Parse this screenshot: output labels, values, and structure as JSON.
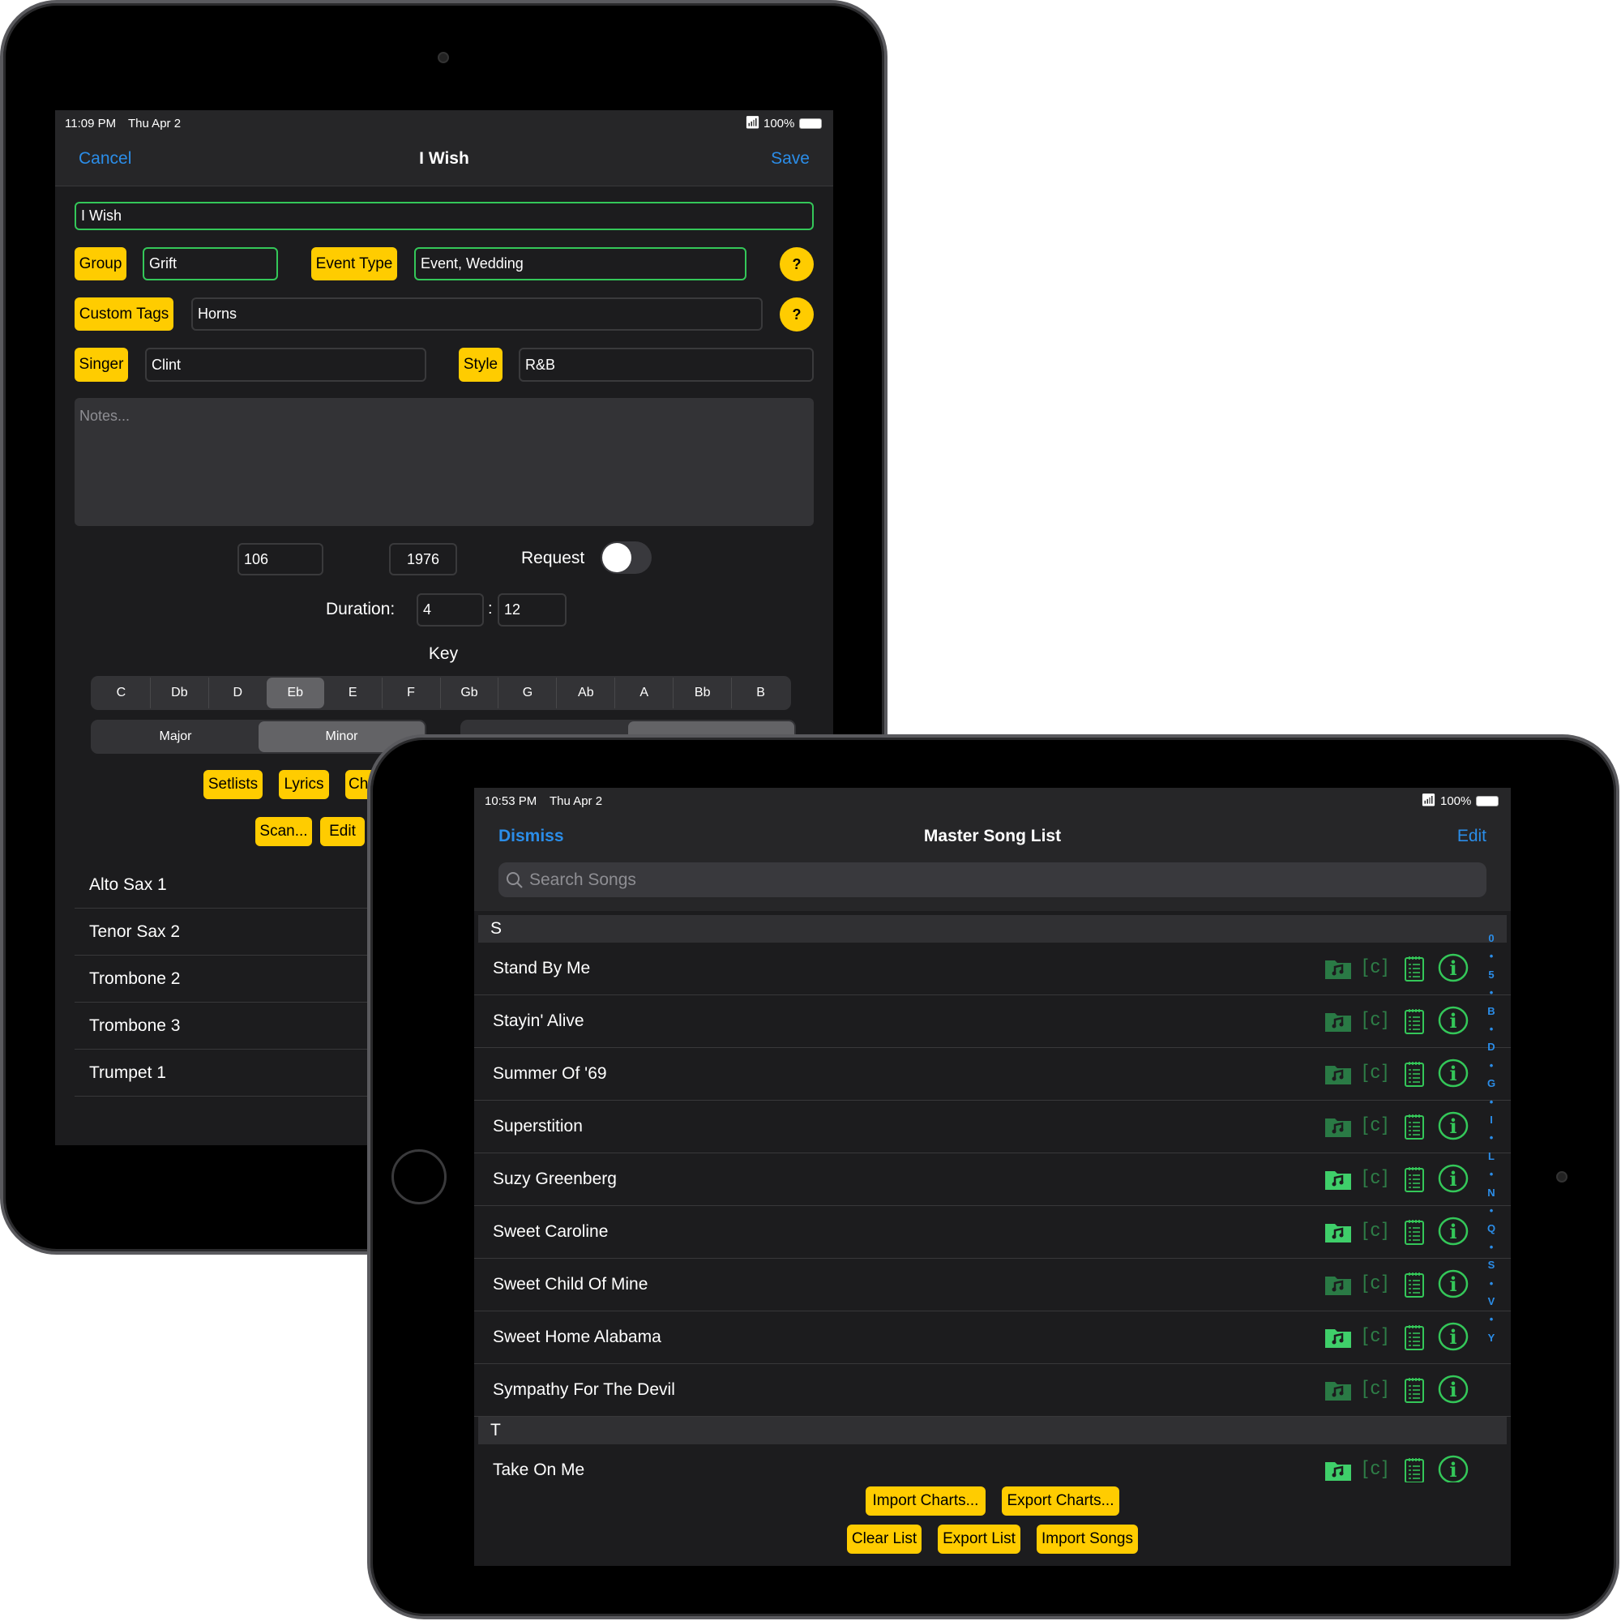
{
  "editor": {
    "status": {
      "time": "11:09 PM",
      "date": "Thu Apr 2",
      "battery": "100%"
    },
    "nav": {
      "cancel": "Cancel",
      "title": "I Wish",
      "save": "Save"
    },
    "title_value": "I Wish",
    "group_label": "Group",
    "group_value": "Grift",
    "event_type_label": "Event Type",
    "event_type_value": "Event, Wedding",
    "help": "?",
    "custom_tags_label": "Custom Tags",
    "custom_tags_value": "Horns",
    "singer_label": "Singer",
    "singer_value": "Clint",
    "style_label": "Style",
    "style_value": "R&B",
    "notes_placeholder": "Notes...",
    "tempo_value": "106",
    "year_value": "1976",
    "request_label": "Request",
    "request_on": false,
    "duration_label": "Duration:",
    "duration_min": "4",
    "duration_sep": ":",
    "duration_sec": "12",
    "key_label": "Key",
    "keys": [
      "C",
      "Db",
      "D",
      "Eb",
      "E",
      "F",
      "Gb",
      "G",
      "Ab",
      "A",
      "Bb",
      "B"
    ],
    "selected_key": "Eb",
    "modes": [
      "Major",
      "Minor"
    ],
    "selected_mode": "Minor",
    "buttons_row1": [
      "Setlists",
      "Lyrics",
      "Ch"
    ],
    "buttons_row2": [
      "Scan...",
      "Edit"
    ],
    "parts": [
      "Alto Sax 1",
      "Tenor Sax 2",
      "Trombone 2",
      "Trombone 3",
      "Trumpet 1"
    ]
  },
  "songlist": {
    "status": {
      "time": "10:53 PM",
      "date": "Thu Apr 2",
      "battery": "100%"
    },
    "nav": {
      "dismiss": "Dismiss",
      "title": "Master Song List",
      "edit": "Edit"
    },
    "search_placeholder": "Search Songs",
    "sections": [
      {
        "letter": "S",
        "songs": [
          {
            "title": "Stand By Me",
            "has_audio": false
          },
          {
            "title": "Stayin' Alive",
            "has_audio": false
          },
          {
            "title": "Summer Of '69",
            "has_audio": false
          },
          {
            "title": "Superstition",
            "has_audio": false
          },
          {
            "title": "Suzy Greenberg",
            "has_audio": true
          },
          {
            "title": "Sweet Caroline",
            "has_audio": true
          },
          {
            "title": "Sweet Child Of Mine",
            "has_audio": false
          },
          {
            "title": "Sweet Home Alabama",
            "has_audio": true
          },
          {
            "title": "Sympathy For The Devil",
            "has_audio": false
          }
        ]
      },
      {
        "letter": "T",
        "songs": [
          {
            "title": "Take On Me",
            "has_audio": true
          }
        ]
      }
    ],
    "chord_icon_text": "[c]",
    "index": [
      "0",
      "•",
      "5",
      "•",
      "B",
      "•",
      "D",
      "•",
      "G",
      "•",
      "I",
      "•",
      "L",
      "•",
      "N",
      "•",
      "Q",
      "•",
      "S",
      "•",
      "V",
      "•",
      "Y"
    ],
    "buttons_row1": [
      "Import Charts...",
      "Export Charts..."
    ],
    "buttons_row2": [
      "Clear List",
      "Export List",
      "Import Songs"
    ]
  },
  "colors": {
    "accent": "#2b8de8",
    "button": "#ffcc00",
    "green": "#34c759",
    "dim_green": "#2e7d47"
  }
}
